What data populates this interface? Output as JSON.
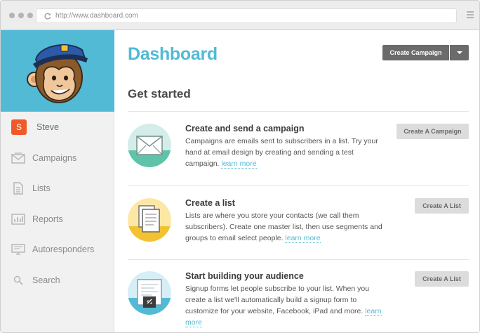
{
  "browser": {
    "url": "http://www.dashboard.com"
  },
  "sidebar": {
    "user": {
      "initial": "S",
      "name": "Steve"
    },
    "items": [
      {
        "label": "Campaigns",
        "icon": "envelope-icon"
      },
      {
        "label": "Lists",
        "icon": "document-icon"
      },
      {
        "label": "Reports",
        "icon": "bar-chart-icon"
      },
      {
        "label": "Autoresponders",
        "icon": "monitor-icon"
      },
      {
        "label": "Search",
        "icon": "search-icon"
      }
    ]
  },
  "header": {
    "title": "Dashboard",
    "create_campaign_label": "Create Campaign"
  },
  "main": {
    "section_title": "Get started",
    "cards": [
      {
        "title": "Create and send a campaign",
        "desc": "Campaigns are emails sent to subscribers in a list. Try your hand at email design by creating and sending a test campaign.",
        "link": "learn more",
        "button": "Create A Campaign",
        "icon": "envelope-icon"
      },
      {
        "title": "Create a list",
        "desc": "Lists are where you store your contacts (we call them subscribers). Create one master list, then use segments and groups to email select people.",
        "link": "learn more",
        "button": "Create A List",
        "icon": "list-document-icon"
      },
      {
        "title": "Start building your audience",
        "desc": "Signup forms let people subscribe to your list. When you create a list we'll automatically build a signup form to customize for your website, Facebook, iPad and more.",
        "link": "learn more",
        "button": "Create A List",
        "icon": "signup-form-icon"
      }
    ]
  },
  "colors": {
    "brand": "#52bad5",
    "avatar": "#f05a28",
    "primary_button": "#6b6b6b",
    "secondary_button": "#dcdcdc"
  }
}
